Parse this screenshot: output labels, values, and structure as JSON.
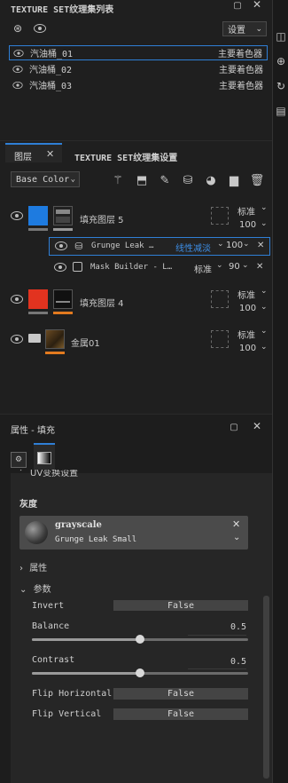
{
  "texture_set_list": {
    "title": "TEXTURE SET纹理集列表",
    "settings_label": "设置",
    "items": [
      {
        "name": "汽油桶_01",
        "shader": "主要着色器"
      },
      {
        "name": "汽油桶_02",
        "shader": "主要着色器"
      },
      {
        "name": "汽油桶_03",
        "shader": "主要着色器"
      }
    ]
  },
  "layers_panel": {
    "tab_layers": "图层",
    "tab_settings": "TEXTURE SET纹理集设置",
    "channel": "Base Color",
    "layers": [
      {
        "name": "填充图层 5",
        "blend": "标准",
        "opacity": "100",
        "color": "#1e7be0"
      },
      {
        "name": "Grunge Leak …",
        "blend": "线性减淡",
        "opacity": "100"
      },
      {
        "name": "Mask Builder - L…",
        "blend": "标准",
        "opacity": "90"
      },
      {
        "name": "填充图层 4",
        "blend": "标准",
        "opacity": "100",
        "color": "#e2331f"
      },
      {
        "name": "金属01",
        "blend": "标准",
        "opacity": "100"
      }
    ]
  },
  "properties": {
    "title": "属性 - 填充",
    "cut_section": "UV变换设置",
    "gray_label": "灰度",
    "resource_name": "grayscale",
    "resource_sub": "Grunge Leak Small",
    "section_attr": "属性",
    "section_params": "参数",
    "params": {
      "invert_label": "Invert",
      "invert_value": "False",
      "balance_label": "Balance",
      "balance_value": "0.5",
      "contrast_label": "Contrast",
      "contrast_value": "0.5",
      "fliph_label": "Flip Horizontal",
      "fliph_value": "False",
      "flipv_label": "Flip Vertical",
      "flipv_value": "False"
    }
  }
}
